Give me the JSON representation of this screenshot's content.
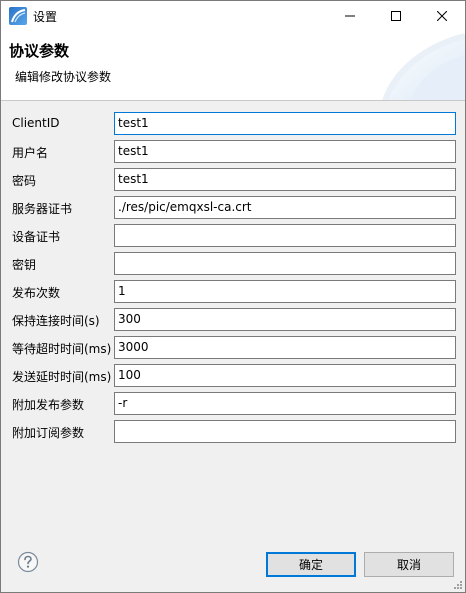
{
  "window": {
    "title": "设置",
    "icons": {
      "app": "app-logo-icon",
      "minimize": "minimize-icon",
      "maximize": "maximize-icon",
      "close": "close-icon"
    }
  },
  "header": {
    "title": "协议参数",
    "subtitle": "编辑修改协议参数"
  },
  "form": {
    "fields": [
      {
        "label": "ClientID",
        "value": "test1"
      },
      {
        "label": "用户名",
        "value": "test1"
      },
      {
        "label": "密码",
        "value": "test1"
      },
      {
        "label": "服务器证书",
        "value": "./res/pic/emqxsl-ca.crt"
      },
      {
        "label": "设备证书",
        "value": ""
      },
      {
        "label": "密钥",
        "value": ""
      },
      {
        "label": "发布次数",
        "value": "1"
      },
      {
        "label": "保持连接时间(s)",
        "value": "300"
      },
      {
        "label": "等待超时时间(ms)",
        "value": "3000"
      },
      {
        "label": "发送延时时间(ms)",
        "value": "100"
      },
      {
        "label": "附加发布参数",
        "value": "-r"
      },
      {
        "label": "附加订阅参数",
        "value": ""
      }
    ]
  },
  "buttons": {
    "ok_label": "确定",
    "cancel_label": "取消",
    "help_icon": "help-icon"
  },
  "colors": {
    "accent": "#0078d7",
    "button_bg": "#e1e1e1",
    "dialog_bg": "#f0f0f0"
  }
}
